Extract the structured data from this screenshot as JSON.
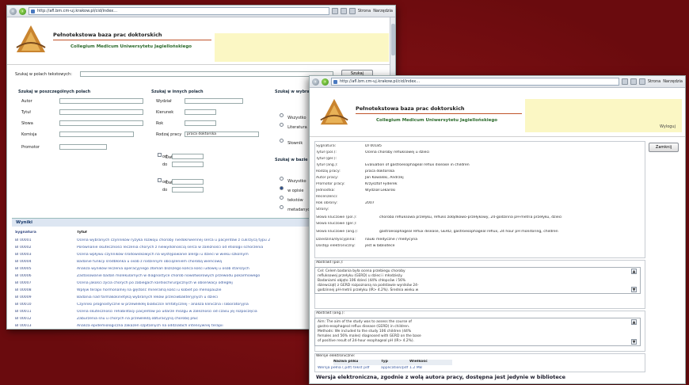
{
  "window1": {
    "url": "http://afl.bm.cm-uj.krakow.pl/cid/index...",
    "menu_tools": "Strona",
    "menu_extra": "Narzędzia",
    "header": {
      "title": "Pełnotekstowa baza prac doktorskich",
      "subtitle": "Collegium Medicum Uniwersytetu Jagiellońskiego"
    },
    "search_all_label": "Szukaj w polach tekstowych:",
    "search_button": "Szukaj",
    "simple_section": "Szukaj w poszczególnych polach",
    "simple_fields": [
      "Autor",
      "Tytuł",
      "Słowa",
      "Komisja",
      "Promotor"
    ],
    "other_section": "Szukaj w innych polach",
    "other_fields": [
      "Wydział",
      "Kierunek",
      "Rok",
      "Rodzaj pracy"
    ],
    "other_select_value": "praca doktorska",
    "checkbox_1": "Data wydania",
    "checkbox_2": "Data obrony",
    "range_od": "od",
    "range_do": "do",
    "third_section": "Szukaj w wybranych słownikach",
    "third_options": [
      "Wszystko",
      "Literatura",
      "Słownik"
    ],
    "fourth_section": "Szukaj w bazie",
    "fourth_options": [
      "Wszystko",
      "w opisie",
      "tekstów",
      "metadanych"
    ],
    "results_header": "Wyniki",
    "results_col_sig": "Sygnatura",
    "results_col_title": "Tytuł",
    "results": [
      {
        "sig": "BI 00001",
        "title": "Ocena wybranych czynników ryzyka rozwoju choroby niedokrwiennej serca u pacjentów z cukrzycą typu 2"
      },
      {
        "sig": "BI 00002",
        "title": "Porównanie skuteczności leczenia chorych z niewydolnością serca w zależności od etiologii schorzenia"
      },
      {
        "sig": "BI 00003",
        "title": "Ocena wpływu czynników środowiskowych na występowanie alergii u dzieci w wieku szkolnym"
      },
      {
        "sig": "BI 00004",
        "title": "Badanie funkcji śródbłonka u osób z rodzinnym obciążeniem chorobą wieńcową"
      },
      {
        "sig": "BI 00005",
        "title": "Analiza wyników leczenia operacyjnego złamań bliższego końca kości udowej u osób starszych"
      },
      {
        "sig": "BI 00006",
        "title": "Zastosowanie badań molekularnych w diagnostyce chorób nowotworowych przewodu pokarmowego"
      },
      {
        "sig": "BI 00007",
        "title": "Ocena jakości życia chorych po zabiegach kardiochirurgicznych w obserwacji odległej"
      },
      {
        "sig": "BI 00008",
        "title": "Wpływ terapii hormonalnej na gęstość mineralną kości u kobiet po menopauzie"
      },
      {
        "sig": "BI 00009",
        "title": "Badania nad farmakokinetyką wybranych leków przeciwbakteryjnych u dzieci"
      },
      {
        "sig": "BI 00010",
        "title": "Czynniki prognostyczne w przewlekłej białaczce limfatycznej - analiza kliniczna i laboratoryjna"
      },
      {
        "sig": "BI 00011",
        "title": "Ocena skuteczności rehabilitacji pacjentów po udarze mózgu w zależności od czasu jej rozpoczęcia"
      },
      {
        "sig": "BI 00012",
        "title": "Zaburzenia snu u chorych na przewlekłą obturacyjną chorobę płuc"
      },
      {
        "sig": "BI 00013",
        "title": "Analiza epidemiologiczna zakażeń szpitalnych na oddziałach intensywnej terapii"
      }
    ]
  },
  "window2": {
    "url": "http://afl.bm.cm-uj.krakow.pl/cid/index...",
    "menu_tools": "Strona",
    "menu_extra": "Narzędzia",
    "header": {
      "title": "Pełnotekstowa baza prac doktorskich",
      "subtitle": "Collegium Medicum Uniwersytetu Jagiellońskiego"
    },
    "logout": "Wyloguj",
    "back_button": "Zamknij",
    "details": [
      {
        "k": "Sygnatura:",
        "v": "DI 00185"
      },
      {
        "k": "Tytuł (pol.):",
        "v": "Ocena choroby refluksowej u dzieci"
      },
      {
        "k": "Tytuł (ger.):",
        "v": ""
      },
      {
        "k": "Tytuł (ang.):",
        "v": "Evaluation of gastroesophageal reflux disease in children"
      },
      {
        "k": "Rodzaj pracy:",
        "v": "praca doktorska"
      },
      {
        "k": "Autor pracy:",
        "v": "Jan Kowalski, Andrzej"
      },
      {
        "k": "Promotor pracy:",
        "v": "Krzysztof Fyderek"
      },
      {
        "k": "Jednostka:",
        "v": "Wydział Lekarski"
      },
      {
        "k": "Recenzenci:",
        "v": ""
      },
      {
        "k": "Rok obrony:",
        "v": "2007"
      },
      {
        "k": "Strony:",
        "v": ""
      },
      {
        "k": "Słowa kluczowe (pol.):",
        "v": "choroba refluksowa przełyku, refluks żołądkowo-przełykowy, 24-godzinna pH-metria przełyku, dzieci"
      },
      {
        "k": "Słowa kluczowe (ger.):",
        "v": ""
      },
      {
        "k": "Słowa kluczowe (ang.):",
        "v": "gastroesophageal reflux disease, GERD, gastroesophageal reflux, 24 hour pH monitoring, children"
      },
      {
        "k": "Dziedzina/dyscyplina:",
        "v": "nauki medyczne / medycyna"
      },
      {
        "k": "Dostęp elektroniczny:",
        "v": "jest w bibliotece"
      }
    ],
    "abstract_pl_label": "Abstrakt (pol.):",
    "abstract_pl": [
      "Cel: Celem badania była ocena przebiegu choroby",
      "refluksowej przełyku (GERD) u dzieci i młodzieży.",
      "Badaniami objęto 106 dzieci (44% chłopców i 56%",
      "dziewcząt) z GERD rozpoznaną na podstawie wyników 24-",
      "godzinnej pH-metrii przełyku (IR> 4.2%). Średnia wieku w"
    ],
    "abstract_en_label": "Abstrakt (ang.):",
    "abstract_en": [
      "Aim: The aim of the study was to assess the course of",
      "gastro-esophageal reflux disease (GERD) in children.",
      "Methods: We included to the study 106 children (44%",
      "females and 56% males) diagnosed with GERD on the base",
      "of positive result of 24-hour esophageal pH (IR> 4.2%)."
    ],
    "files_label": "Wersje elektroniczne:",
    "files_head": [
      "Nazwa pliku",
      "Typ",
      "Wielkość"
    ],
    "files_row": [
      "Wersja pełna (.pdf) tekst pdf",
      "application/pdf",
      "1.2 MB"
    ],
    "bottom_note": "Wersja elektroniczna, zgodnie z wolą autora pracy, dostępna jest jedynie w bibliotece"
  }
}
